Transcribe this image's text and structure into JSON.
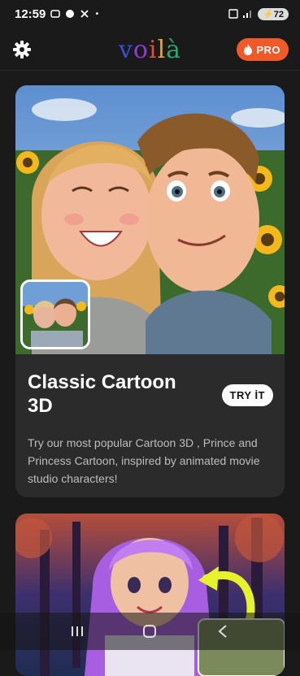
{
  "status_bar": {
    "time": "12:59",
    "battery": "72"
  },
  "header": {
    "logo": [
      "v",
      "o",
      "i",
      "l",
      "à"
    ],
    "pro_label": "PRO"
  },
  "featured_card": {
    "title": "Classic Cartoon 3D",
    "button_label": "TRY İT",
    "description": "Try our most popular Cartoon 3D , Prince and Princess Cartoon, inspired by animated movie studio characters!"
  },
  "colors": {
    "accent": "#f05a28",
    "background": "#1a1a1a",
    "card": "#2b2b2b"
  },
  "icons": {
    "settings": "gear-icon",
    "pro": "flame-icon",
    "nav_recent": "recent-apps-icon",
    "nav_home": "home-icon",
    "nav_back": "back-icon"
  }
}
